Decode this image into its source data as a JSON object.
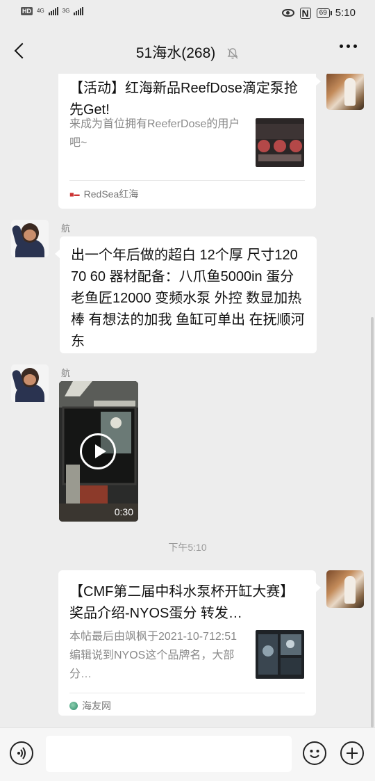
{
  "status_bar": {
    "hd_label": "HD",
    "sim1_network": "4G",
    "sim2_network": "3G",
    "battery": "69",
    "time": "5:10"
  },
  "header": {
    "title": "51海水(268)",
    "back_icon": "chevron-left-icon",
    "mute_icon": "bell-off-icon",
    "more_icon": "more-dots-icon"
  },
  "messages": [
    {
      "type": "link_card",
      "side": "right",
      "title": "【活动】红海新品ReefDose滴定泵抢先Get!",
      "description": "来成为首位拥有ReeferDose的用户吧~",
      "source": "RedSea红海"
    },
    {
      "type": "text",
      "side": "left",
      "sender": "航",
      "text": "出一个年后做的超白 12个厚 尺寸120 70 60  器材配备：八爪鱼5000in 蛋分  老鱼匠12000 变频水泵 外控 数显加热棒  有想法的加我 鱼缸可单出 在抚顺河东"
    },
    {
      "type": "video",
      "side": "left",
      "sender": "航",
      "duration": "0:30"
    },
    {
      "type": "time",
      "text": "下午5:10"
    },
    {
      "type": "link_card",
      "side": "right",
      "title": "【CMF第二届中科水泵杯开缸大赛】奖品介绍-NYOS蛋分 转发…",
      "description": "本帖最后由飒枫于2021-10-712:51编辑说到NYOS这个品牌名，大部分…",
      "source": "海友网"
    }
  ],
  "input_bar": {
    "voice_icon": "voice-icon",
    "emoji_icon": "emoji-icon",
    "plus_icon": "plus-icon",
    "placeholder": ""
  }
}
